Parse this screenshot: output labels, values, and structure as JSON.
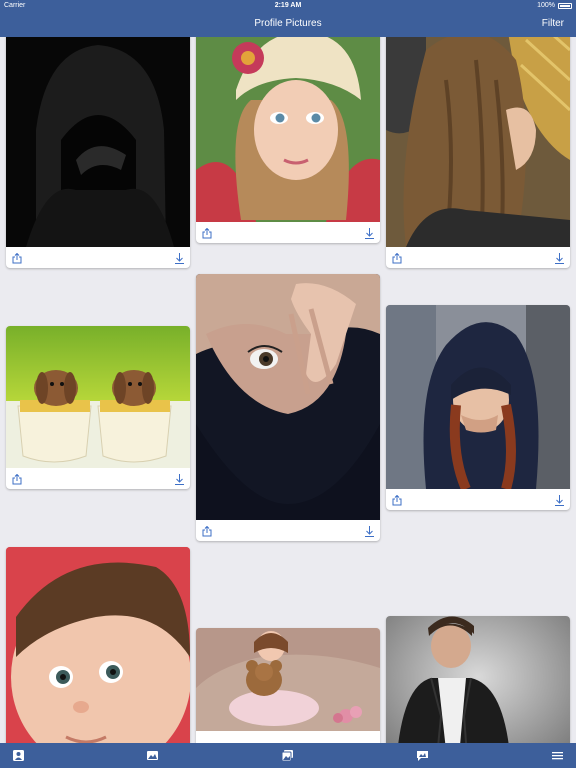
{
  "status": {
    "carrier": "Carrier",
    "time": "2:19 AM",
    "battery": "100%"
  },
  "nav": {
    "title": "Profile Pictures",
    "filter_label": "Filter"
  },
  "cards": [
    {
      "name": "hooded-figure-photo",
      "description": "hooded figure"
    },
    {
      "name": "girl-knit-hat-photo",
      "description": "girl in knit hat"
    },
    {
      "name": "long-hair-girl-photo",
      "description": "girl with long hair"
    },
    {
      "name": "bunnies-in-cups-photo",
      "description": "bunnies in cups"
    },
    {
      "name": "eye-hand-photo",
      "description": "eye and hand"
    },
    {
      "name": "hooded-girl-photo",
      "description": "girl in hood"
    },
    {
      "name": "baby-photo",
      "description": "baby face"
    },
    {
      "name": "girl-teddy-photo",
      "description": "girl with teddy bear"
    },
    {
      "name": "man-jacket-photo",
      "description": "man in leather jacket"
    }
  ],
  "tabs": [
    "profile-icon",
    "picture-icon",
    "gallery-icon",
    "chat-photo-icon",
    "menu-icon"
  ],
  "colors": {
    "bar": "#3d5f9b",
    "background": "#ebebf0",
    "icon": "#3d6fc6"
  }
}
